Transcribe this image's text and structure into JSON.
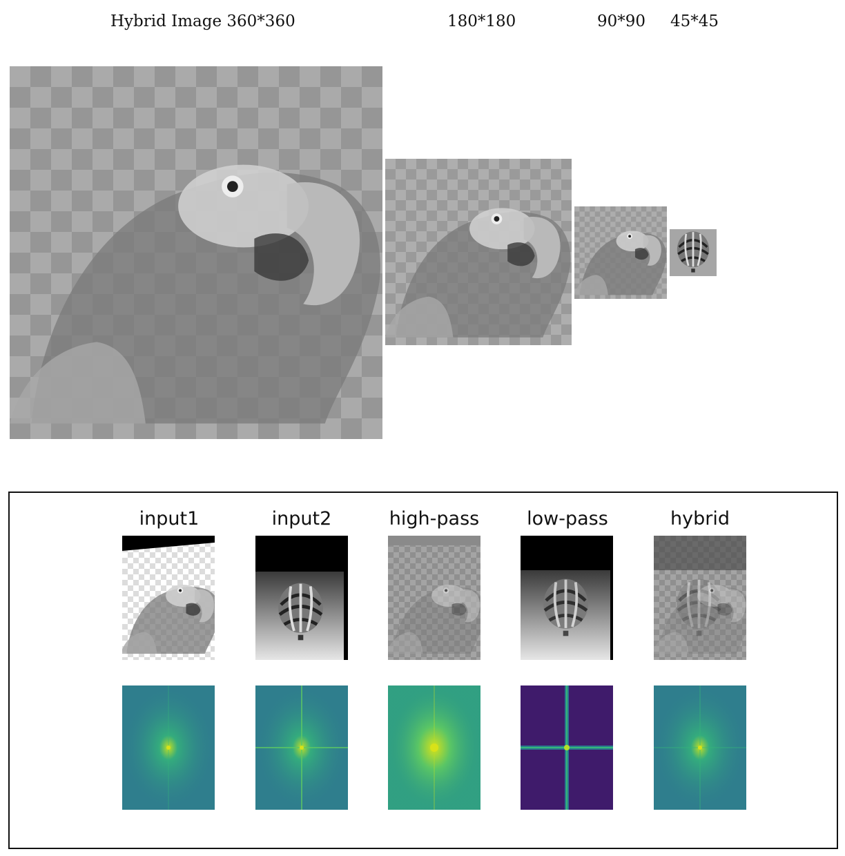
{
  "captions": {
    "hybrid_360": "Hybrid Image 360*360",
    "size_180": "180*180",
    "size_90": "90*90",
    "size_45": "45*45"
  },
  "pyramid_images": [
    {
      "name": "hybrid-image-360",
      "content": "grayscale parrot hybrid image"
    },
    {
      "name": "hybrid-image-180",
      "content": "grayscale parrot hybrid image"
    },
    {
      "name": "hybrid-image-90",
      "content": "grayscale parrot hybrid image"
    },
    {
      "name": "hybrid-image-45",
      "content": "grayscale balloon-like hybrid image"
    }
  ],
  "panel": {
    "columns": [
      {
        "title": "input1"
      },
      {
        "title": "input2"
      },
      {
        "title": "high-pass"
      },
      {
        "title": "low-pass"
      },
      {
        "title": "hybrid"
      }
    ]
  },
  "colors": {
    "spectrum_background": "#2f7e8d",
    "spectrum_low_pass_background": "#3f1b6b",
    "spectrum_peak": "#b8de29"
  }
}
